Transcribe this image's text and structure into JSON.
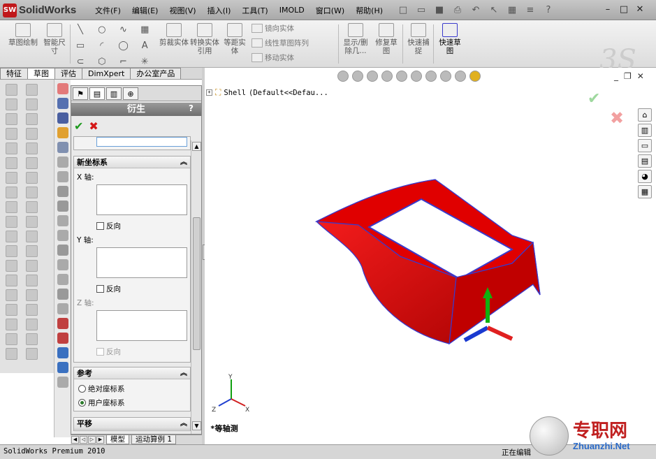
{
  "app": {
    "name": "SolidWorks",
    "logo_text": "SW"
  },
  "menu": [
    "文件(F)",
    "编辑(E)",
    "视图(V)",
    "插入(I)",
    "工具(T)",
    "IMOLD",
    "窗口(W)",
    "帮助(H)"
  ],
  "ribbon": {
    "sketch": "草图绘制",
    "smart_dim": "智能尺寸",
    "trim": "剪裁实体",
    "convert": "转换实体引用",
    "offset": "等距实体",
    "mirror": "镜向实体",
    "linear_pattern": "线性草图阵列",
    "move": "移动实体",
    "show_delete": "显示/删除几...",
    "repair": "修复草图",
    "quick_snap": "快速捕捉",
    "rapid_sketch": "快速草图"
  },
  "tabs": [
    "特征",
    "草图",
    "评估",
    "DimXpert",
    "办公室产品"
  ],
  "tabs_active": 1,
  "pm": {
    "title": "衍生",
    "help": "?",
    "group_new_csys": "新坐标系",
    "x_axis": "X 轴:",
    "y_axis": "Y 轴:",
    "z_axis": "Z 轴:",
    "reverse": "反向",
    "group_ref": "参考",
    "abs_csys": "绝对座标系",
    "user_csys": "用户座标系",
    "group_translate": "平移"
  },
  "bottom_tabs": [
    "模型",
    "运动算例 1"
  ],
  "tree": {
    "name": "Shell",
    "config": "(Default<<Defau..."
  },
  "view": {
    "label": "*等轴测"
  },
  "triad": {
    "x": "X",
    "y": "Y",
    "z": "Z"
  },
  "status": {
    "left": "SolidWorks Premium 2010",
    "editing": "正在编辑"
  },
  "watermark": {
    "cn": "专职网",
    "en": "Zhuanzhi.Net"
  },
  "colors": {
    "part": "#d40000",
    "edge": "#3a3acc",
    "accent": "#1e9a1e"
  }
}
